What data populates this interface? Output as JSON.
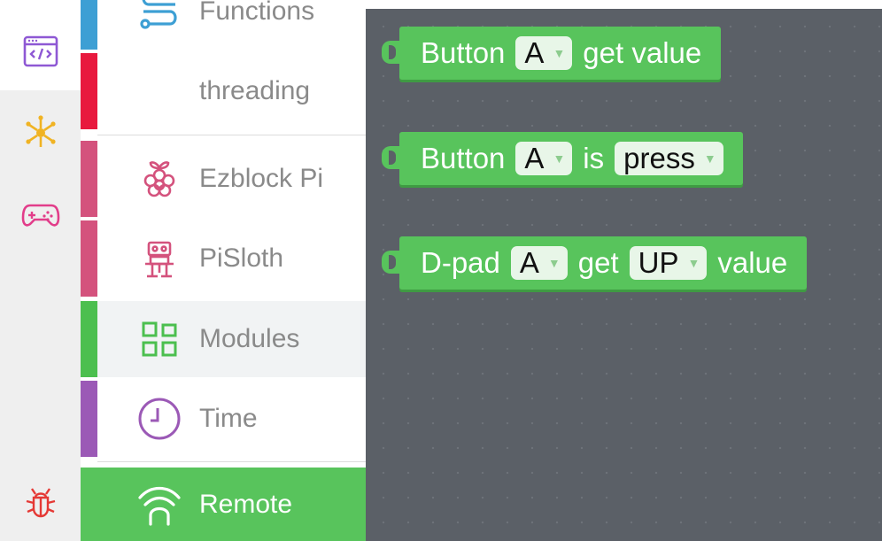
{
  "rail": {
    "items": [
      {
        "name": "code-editor",
        "color": "#8e58d4"
      },
      {
        "name": "connections",
        "color": "#f0b323"
      },
      {
        "name": "gamepad",
        "color": "#e23d8a"
      },
      {
        "name": "debug",
        "color": "#e53935"
      }
    ]
  },
  "categories": [
    {
      "label": "Functions",
      "color": "#3d9fd4"
    },
    {
      "label": "threading",
      "color": "#e8193e"
    },
    {
      "label": "Ezblock Pi",
      "color": "#d4527d"
    },
    {
      "label": "PiSloth",
      "color": "#d4527d"
    },
    {
      "label": "Modules",
      "color": "#4cbf4f",
      "selected": true
    },
    {
      "label": "Time",
      "color": "#9b59b6"
    },
    {
      "label": "Remote",
      "color": "#58c45c",
      "active": true
    }
  ],
  "blocks": [
    {
      "parts": [
        "Button",
        {
          "dropdown": "A"
        },
        "get value"
      ]
    },
    {
      "parts": [
        "Button",
        {
          "dropdown": "A"
        },
        "is",
        {
          "dropdown": "press"
        }
      ]
    },
    {
      "parts": [
        "D-pad",
        {
          "dropdown": "A"
        },
        "get",
        {
          "dropdown": "UP"
        },
        "value"
      ]
    }
  ],
  "block1": {
    "t1": "Button",
    "d1": "A",
    "t2": "get value"
  },
  "block2": {
    "t1": "Button",
    "d1": "A",
    "t2": "is",
    "d2": "press"
  },
  "block3": {
    "t1": "D-pad",
    "d1": "A",
    "t2": "get",
    "d2": "UP",
    "t3": "value"
  },
  "colors": {
    "block": "#58c45c",
    "workspace": "#5b6067"
  }
}
